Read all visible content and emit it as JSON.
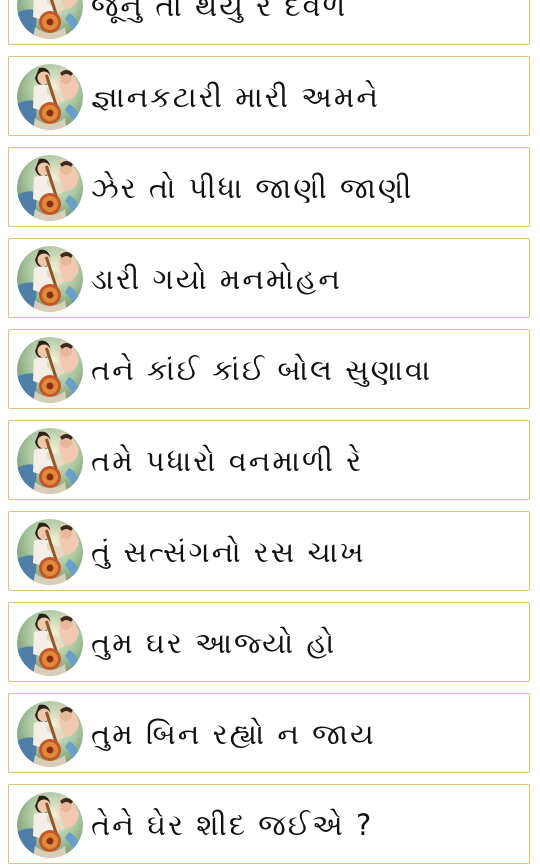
{
  "songs": [
    {
      "title": "જૂનું તો થયું રે દેવળ",
      "icon": "meera-portrait-icon"
    },
    {
      "title": "જ્ઞાનકટારી મારી અમને",
      "icon": "meera-portrait-icon"
    },
    {
      "title": "ઝેર તો પીધા જાણી જાણી",
      "icon": "meera-portrait-icon"
    },
    {
      "title": "ડારી ગયો મનમોહન",
      "icon": "meera-portrait-icon"
    },
    {
      "title": "તને કાંઈ કાંઈ બોલ સુણાવા",
      "icon": "meera-portrait-icon"
    },
    {
      "title": "તમે પધારો વનમાળી રે",
      "icon": "meera-portrait-icon"
    },
    {
      "title": "તું સત્સંગનો રસ ચાખ",
      "icon": "meera-portrait-icon"
    },
    {
      "title": "તુમ ઘર આજ્યો હો",
      "icon": "meera-portrait-icon"
    },
    {
      "title": "તુમ બિન રહ્યો ન જાય",
      "icon": "meera-portrait-icon"
    },
    {
      "title": "તેને ઘેર શીદ જઈએ ?",
      "icon": "meera-portrait-icon"
    }
  ],
  "colors": {
    "item_border": "#e2c27a",
    "text": "#111111",
    "background": "#ffffff"
  }
}
